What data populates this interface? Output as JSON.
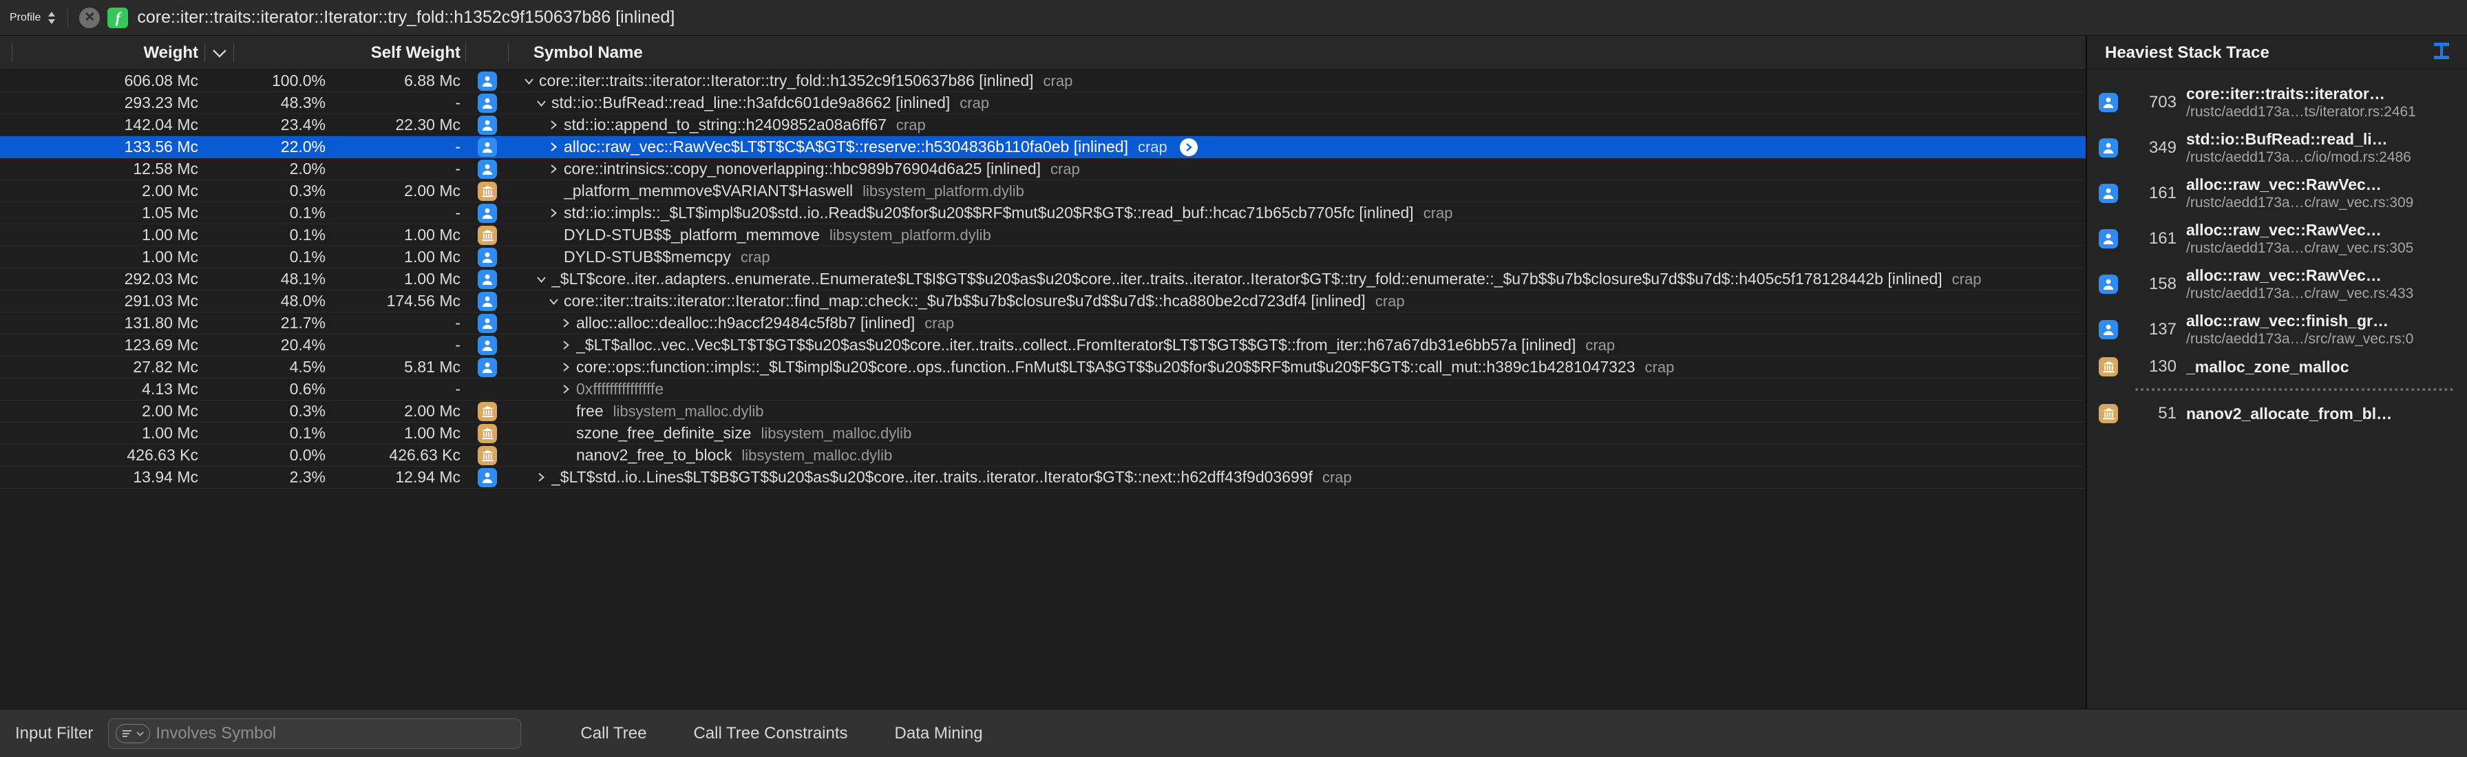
{
  "jumpbar": {
    "profile_label": "Profile",
    "close_label": "✕",
    "function_glyph": "f",
    "path": "core::iter::traits::iterator::Iterator::try_fold::h1352c9f150637b86 [inlined]"
  },
  "table": {
    "columns": {
      "weight": "Weight",
      "self_weight": "Self Weight",
      "symbol_name": "Symbol Name"
    },
    "rows": [
      {
        "weight": "606.08 Mc",
        "pct": "100.0%",
        "self": "6.88 Mc",
        "icon": "user",
        "depth": 0,
        "disc": "down",
        "symbol": "core::iter::traits::iterator::Iterator::try_fold::h1352c9f150637b86 [inlined]",
        "module": "crap",
        "selected": false,
        "badge": false
      },
      {
        "weight": "293.23 Mc",
        "pct": "48.3%",
        "self": "-",
        "icon": "user",
        "depth": 1,
        "disc": "down",
        "symbol": "std::io::BufRead::read_line::h3afdc601de9a8662 [inlined]",
        "module": "crap",
        "selected": false,
        "badge": false
      },
      {
        "weight": "142.04 Mc",
        "pct": "23.4%",
        "self": "22.30 Mc",
        "icon": "user",
        "depth": 2,
        "disc": "right",
        "symbol": "std::io::append_to_string::h2409852a08a6ff67",
        "module": "crap",
        "selected": false,
        "badge": false
      },
      {
        "weight": "133.56 Mc",
        "pct": "22.0%",
        "self": "-",
        "icon": "user",
        "depth": 2,
        "disc": "right",
        "symbol": "alloc::raw_vec::RawVec$LT$T$C$A$GT$::reserve::h5304836b110fa0eb [inlined]",
        "module": "crap",
        "selected": true,
        "badge": true
      },
      {
        "weight": "12.58 Mc",
        "pct": "2.0%",
        "self": "-",
        "icon": "user",
        "depth": 2,
        "disc": "right",
        "symbol": "core::intrinsics::copy_nonoverlapping::hbc989b76904d6a25 [inlined]",
        "module": "crap",
        "selected": false,
        "badge": false
      },
      {
        "weight": "2.00 Mc",
        "pct": "0.3%",
        "self": "2.00 Mc",
        "icon": "lib",
        "depth": 2,
        "disc": "none",
        "symbol": "_platform_memmove$VARIANT$Haswell",
        "module": "libsystem_platform.dylib",
        "selected": false,
        "badge": false
      },
      {
        "weight": "1.05 Mc",
        "pct": "0.1%",
        "self": "-",
        "icon": "user",
        "depth": 2,
        "disc": "right",
        "symbol": "std::io::impls::_$LT$impl$u20$std..io..Read$u20$for$u20$$RF$mut$u20$R$GT$::read_buf::hcac71b65cb7705fc [inlined]",
        "module": "crap",
        "selected": false,
        "badge": false
      },
      {
        "weight": "1.00 Mc",
        "pct": "0.1%",
        "self": "1.00 Mc",
        "icon": "lib",
        "depth": 2,
        "disc": "none",
        "symbol": "DYLD-STUB$$_platform_memmove",
        "module": "libsystem_platform.dylib",
        "selected": false,
        "badge": false
      },
      {
        "weight": "1.00 Mc",
        "pct": "0.1%",
        "self": "1.00 Mc",
        "icon": "user",
        "depth": 2,
        "disc": "none",
        "symbol": "DYLD-STUB$$memcpy",
        "module": "crap",
        "selected": false,
        "badge": false
      },
      {
        "weight": "292.03 Mc",
        "pct": "48.1%",
        "self": "1.00 Mc",
        "icon": "user",
        "depth": 1,
        "disc": "down",
        "symbol": "_$LT$core..iter..adapters..enumerate..Enumerate$LT$I$GT$$u20$as$u20$core..iter..traits..iterator..Iterator$GT$::try_fold::enumerate::_$u7b$$u7b$closure$u7d$$u7d$::h405c5f178128442b [inlined]",
        "module": "crap",
        "selected": false,
        "badge": false
      },
      {
        "weight": "291.03 Mc",
        "pct": "48.0%",
        "self": "174.56 Mc",
        "icon": "user",
        "depth": 2,
        "disc": "down",
        "symbol": "core::iter::traits::iterator::Iterator::find_map::check::_$u7b$$u7b$closure$u7d$$u7d$::hca880be2cd723df4 [inlined]",
        "module": "crap",
        "selected": false,
        "badge": false
      },
      {
        "weight": "131.80 Mc",
        "pct": "21.7%",
        "self": "-",
        "icon": "user",
        "depth": 3,
        "disc": "right",
        "symbol": "alloc::alloc::dealloc::h9accf29484c5f8b7 [inlined]",
        "module": "crap",
        "selected": false,
        "badge": false
      },
      {
        "weight": "123.69 Mc",
        "pct": "20.4%",
        "self": "-",
        "icon": "user",
        "depth": 3,
        "disc": "right",
        "symbol": "_$LT$alloc..vec..Vec$LT$T$GT$$u20$as$u20$core..iter..traits..collect..FromIterator$LT$T$GT$$GT$::from_iter::h67a67db31e6bb57a [inlined]",
        "module": "crap",
        "selected": false,
        "badge": false
      },
      {
        "weight": "27.82 Mc",
        "pct": "4.5%",
        "self": "5.81 Mc",
        "icon": "user",
        "depth": 3,
        "disc": "right",
        "symbol": "core::ops::function::impls::_$LT$impl$u20$core..ops..function..FnMut$LT$A$GT$$u20$for$u20$$RF$mut$u20$F$GT$::call_mut::h389c1b4281047323",
        "module": "crap",
        "selected": false,
        "badge": false
      },
      {
        "weight": "4.13 Mc",
        "pct": "0.6%",
        "self": "-",
        "icon": "none",
        "depth": 3,
        "disc": "right",
        "symbol": "0xfffffffffffffffe",
        "module": "",
        "selected": false,
        "badge": false,
        "dim": true
      },
      {
        "weight": "2.00 Mc",
        "pct": "0.3%",
        "self": "2.00 Mc",
        "icon": "lib",
        "depth": 3,
        "disc": "none",
        "symbol": "free",
        "module": "libsystem_malloc.dylib",
        "selected": false,
        "badge": false
      },
      {
        "weight": "1.00 Mc",
        "pct": "0.1%",
        "self": "1.00 Mc",
        "icon": "lib",
        "depth": 3,
        "disc": "none",
        "symbol": "szone_free_definite_size",
        "module": "libsystem_malloc.dylib",
        "selected": false,
        "badge": false
      },
      {
        "weight": "426.63 Kc",
        "pct": "0.0%",
        "self": "426.63 Kc",
        "icon": "lib",
        "depth": 3,
        "disc": "none",
        "symbol": "nanov2_free_to_block",
        "module": "libsystem_malloc.dylib",
        "selected": false,
        "badge": false
      },
      {
        "weight": "13.94 Mc",
        "pct": "2.3%",
        "self": "12.94 Mc",
        "icon": "user",
        "depth": 1,
        "disc": "right",
        "symbol": "_$LT$std..io..Lines$LT$B$GT$$u20$as$u20$core..iter..traits..iterator..Iterator$GT$::next::h62dff43f9d03699f",
        "module": "crap",
        "selected": false,
        "badge": false
      }
    ]
  },
  "stack_panel": {
    "title": "Heaviest Stack Trace",
    "entries": [
      {
        "icon": "user",
        "count": "703",
        "name": "core::iter::traits::iterator…",
        "location": "/rustc/aedd173a…ts/iterator.rs:2461"
      },
      {
        "icon": "user",
        "count": "349",
        "name": "std::io::BufRead::read_li…",
        "location": "/rustc/aedd173a…c/io/mod.rs:2486"
      },
      {
        "icon": "user",
        "count": "161",
        "name": "alloc::raw_vec::RawVec…",
        "location": "/rustc/aedd173a…c/raw_vec.rs:309"
      },
      {
        "icon": "user",
        "count": "161",
        "name": "alloc::raw_vec::RawVec…",
        "location": "/rustc/aedd173a…c/raw_vec.rs:305"
      },
      {
        "icon": "user",
        "count": "158",
        "name": "alloc::raw_vec::RawVec…",
        "location": "/rustc/aedd173a…c/raw_vec.rs:433"
      },
      {
        "icon": "user",
        "count": "137",
        "name": "alloc::raw_vec::finish_gr…",
        "location": "/rustc/aedd173a…/src/raw_vec.rs:0"
      },
      {
        "icon": "lib",
        "count": "130",
        "name": "_malloc_zone_malloc",
        "location": ""
      },
      {
        "separator": true
      },
      {
        "icon": "lib",
        "count": "51",
        "name": "nanov2_allocate_from_bl…",
        "location": ""
      }
    ]
  },
  "bottombar": {
    "input_filter_label": "Input Filter",
    "filter_placeholder": "Involves Symbol",
    "tabs": [
      "Call Tree",
      "Call Tree Constraints",
      "Data Mining"
    ]
  },
  "colors": {
    "selection": "#0a5bd3",
    "user_icon": "#2f8cf0",
    "lib_icon": "#d9a860",
    "accent_green": "#35c759"
  }
}
